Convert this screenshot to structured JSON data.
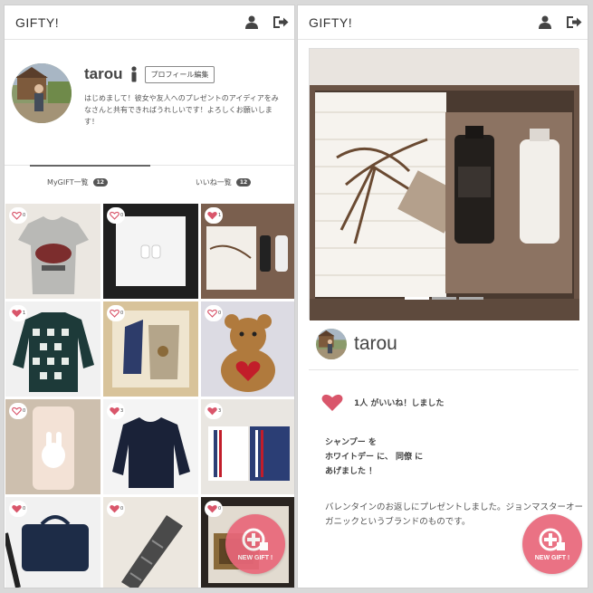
{
  "app": {
    "brand": "GIFTY!"
  },
  "header_icons": [
    "user-icon",
    "logout-icon"
  ],
  "profile": {
    "name": "tarou",
    "edit_label": "プロフィール編集",
    "bio": "はじめまして！彼女や友人へのプレゼントのアイディアをみなさんと共有できればうれしいです！よろしくお願いします！"
  },
  "tabs": [
    {
      "label": "MyGIFT一覧",
      "count": "12"
    },
    {
      "label": "いいね一覧",
      "count": "12"
    }
  ],
  "gifts": [
    {
      "item": "t-shirt",
      "liked": false,
      "count": "0"
    },
    {
      "item": "earbuds",
      "liked": false,
      "count": "0"
    },
    {
      "item": "towel-gift-set",
      "liked": true,
      "count": "1"
    },
    {
      "item": "sweater",
      "liked": true,
      "count": "1"
    },
    {
      "item": "vest-set",
      "liked": false,
      "count": "0"
    },
    {
      "item": "teddy-bear",
      "liked": false,
      "count": "0"
    },
    {
      "item": "phone-case",
      "liked": false,
      "count": "0"
    },
    {
      "item": "navy-sweater",
      "liked": true,
      "count": "3"
    },
    {
      "item": "handkerchiefs",
      "liked": true,
      "count": "3"
    },
    {
      "item": "bag",
      "liked": true,
      "count": "0"
    },
    {
      "item": "necktie",
      "liked": true,
      "count": "0"
    },
    {
      "item": "wallet",
      "liked": true,
      "count": "0"
    }
  ],
  "fab": {
    "label": "NEW GIFT !"
  },
  "detail": {
    "author": "tarou",
    "likes_text": "1人 がいいね！しました",
    "line1": "シャンプー を",
    "line2": "ホワイトデー に、 同僚 に",
    "line3": "あげました ！",
    "message": "バレンタインのお返しにプレゼントしました。ジョンマスターオーガニックというブランドのものです。"
  },
  "colors": {
    "accent": "#e9677a",
    "heart": "#d9566b"
  }
}
